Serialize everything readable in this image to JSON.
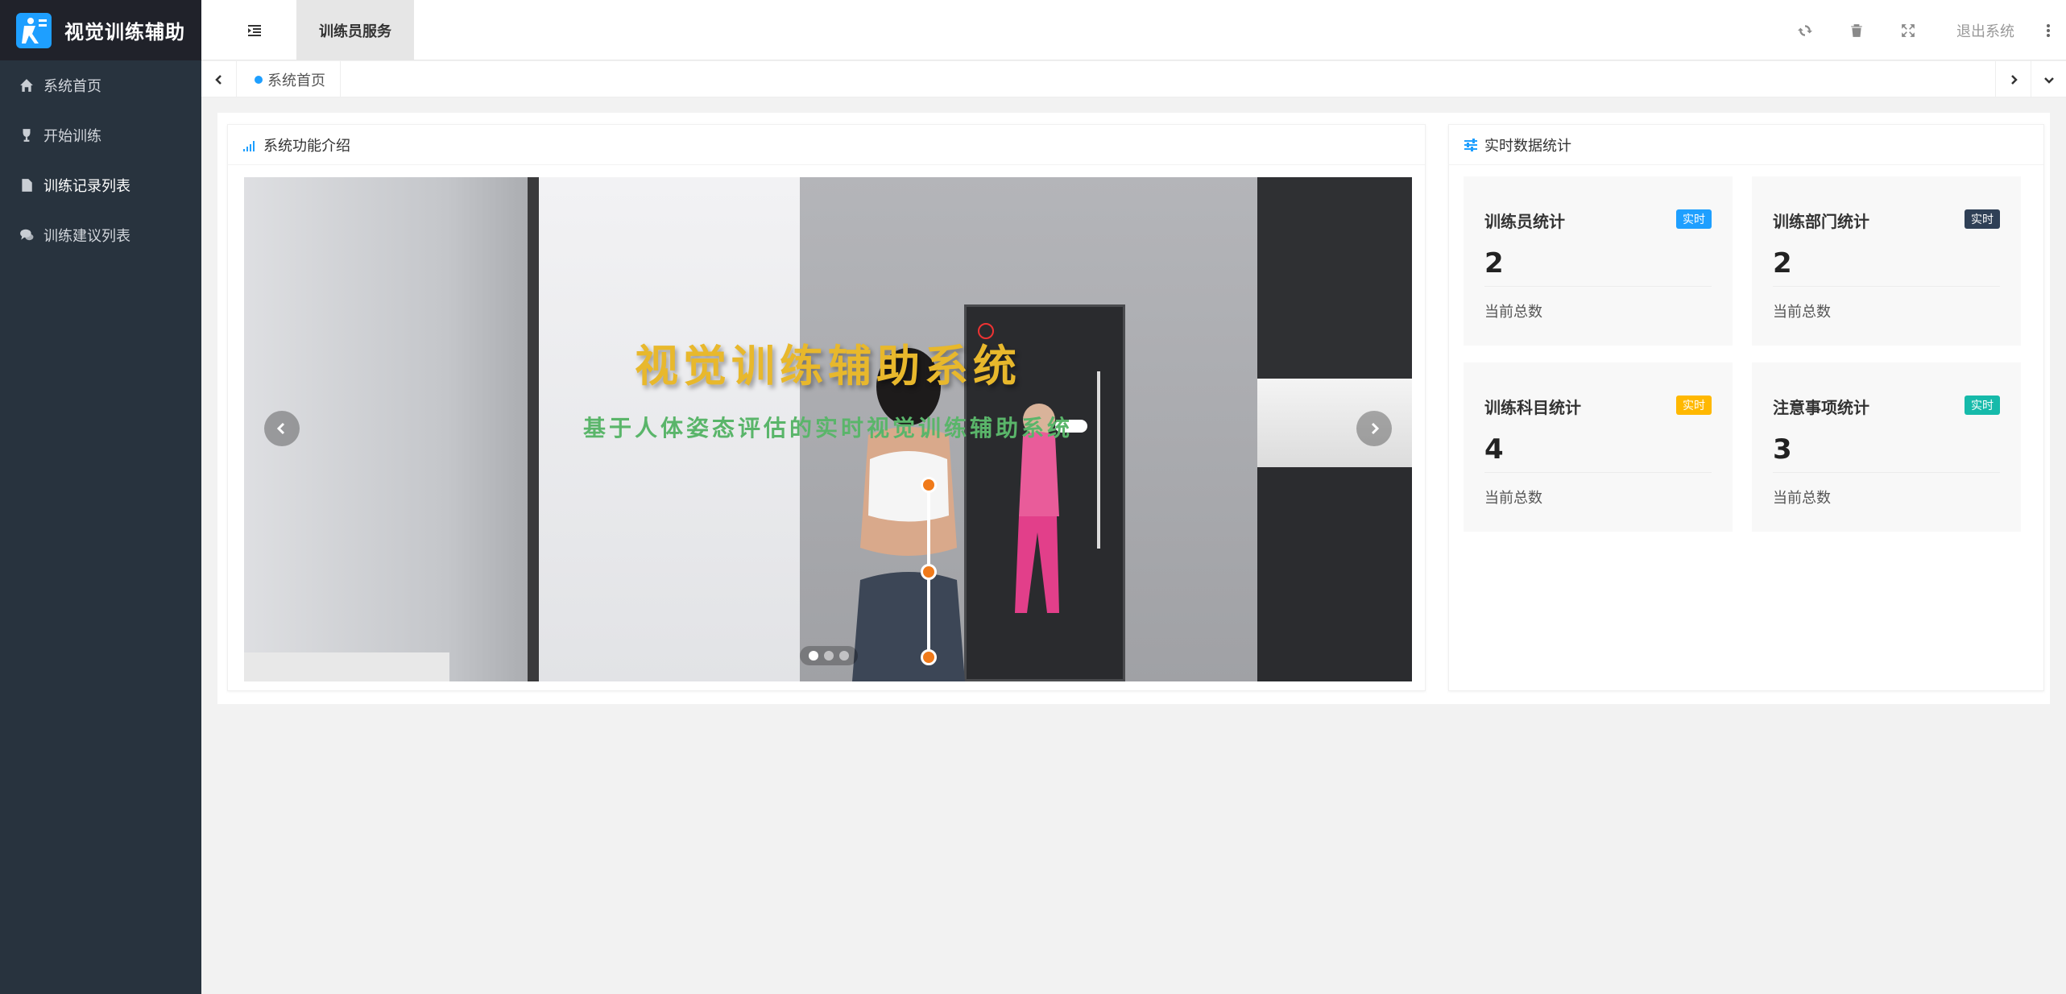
{
  "app": {
    "title": "视觉训练辅助"
  },
  "sidebar": {
    "items": [
      {
        "label": "系统首页",
        "icon": "home-icon"
      },
      {
        "label": "开始训练",
        "icon": "trophy-icon"
      },
      {
        "label": "训练记录列表",
        "icon": "file-icon"
      },
      {
        "label": "训练建议列表",
        "icon": "comments-icon"
      }
    ]
  },
  "header": {
    "nav_tab": "训练员服务",
    "logout": "退出系统",
    "tools": [
      "refresh-icon",
      "trash-icon",
      "fullscreen-icon"
    ]
  },
  "tabs": {
    "items": [
      {
        "label": "系统首页",
        "active": true
      }
    ]
  },
  "intro": {
    "title": "系统功能介绍",
    "carousel": {
      "main_text": "视觉训练辅助系统",
      "sub_text": "基于人体姿态评估的实时视觉训练辅助系统",
      "slides": 3,
      "active_slide": 1
    }
  },
  "stats": {
    "title": "实时数据统计",
    "cards": [
      {
        "title": "训练员统计",
        "badge": "实时",
        "badge_color": "#1e9fff",
        "value": "2",
        "foot": "当前总数"
      },
      {
        "title": "训练部门统计",
        "badge": "实时",
        "badge_color": "#2f4056",
        "value": "2",
        "foot": "当前总数"
      },
      {
        "title": "训练科目统计",
        "badge": "实时",
        "badge_color": "#ffb800",
        "value": "4",
        "foot": "当前总数"
      },
      {
        "title": "注意事项统计",
        "badge": "实时",
        "badge_color": "#16baaa",
        "value": "3",
        "foot": "当前总数"
      }
    ]
  },
  "colors": {
    "sidebar_bg": "#28333e",
    "logo_bg": "#20222a",
    "accent": "#1e9fff"
  }
}
